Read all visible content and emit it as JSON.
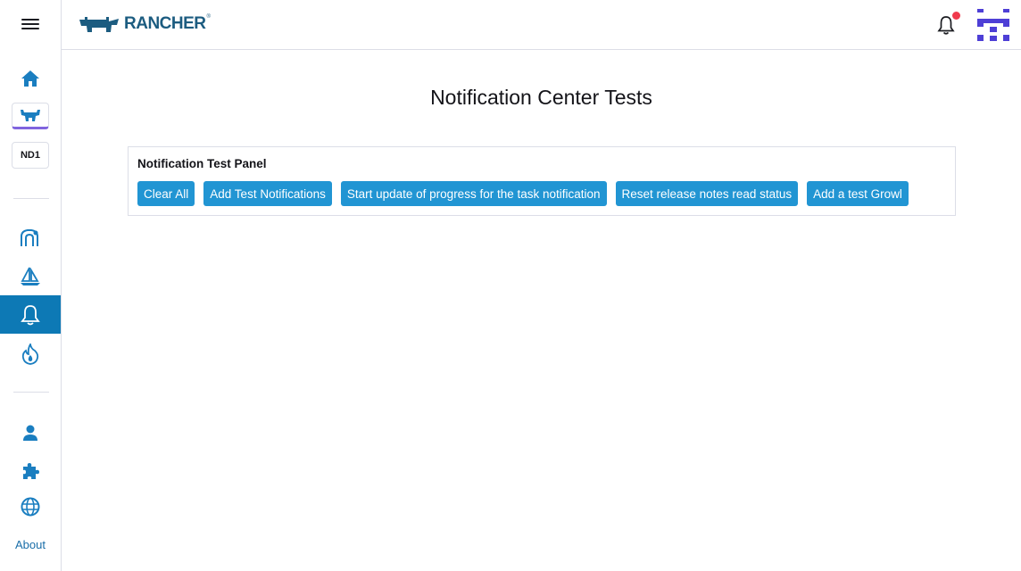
{
  "app": {
    "name": "RANCHER",
    "registered_mark": "®"
  },
  "sidebar": {
    "cluster_badge": "ND1",
    "about_label": "About",
    "items": [
      {
        "icon": "home-icon"
      },
      {
        "icon": "rancher-cow-icon"
      },
      {
        "icon": "cluster-nd1-badge"
      },
      {
        "icon": "continuous-delivery-icon"
      },
      {
        "icon": "fleet-sailboat-icon"
      },
      {
        "icon": "notification-bell-icon",
        "selected": true
      },
      {
        "icon": "harvester-fire-icon"
      },
      {
        "icon": "users-icon"
      },
      {
        "icon": "extensions-puzzle-icon"
      },
      {
        "icon": "global-settings-globe-icon"
      }
    ]
  },
  "header": {
    "has_unread_notifications": true
  },
  "main": {
    "title": "Notification Center Tests",
    "panel": {
      "title": "Notification Test Panel",
      "buttons": [
        "Clear All",
        "Add Test Notifications",
        "Start update of progress for the task notification",
        "Reset release notes read status",
        "Add a test Growl"
      ]
    }
  },
  "colors": {
    "accent_blue": "#2195d3",
    "selected_nav": "#0d79b5",
    "logo_blue": "#1c5c80",
    "notification_dot": "#f03a4d",
    "active_cluster_underline": "#8064de",
    "avatar_purple": "#4e3fd6"
  }
}
